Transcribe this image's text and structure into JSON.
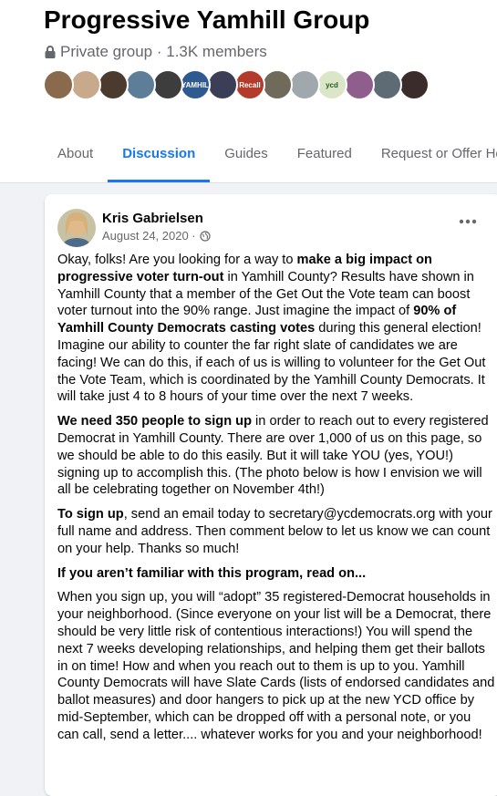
{
  "group": {
    "title": "Progressive Yamhill Group",
    "privacy": "Private group",
    "separator": " · ",
    "members": "1.3K members"
  },
  "member_avatars": [
    {
      "color": "#8a6a4c",
      "label": ""
    },
    {
      "color": "#c9a98b",
      "label": ""
    },
    {
      "color": "#4b3a2e",
      "label": ""
    },
    {
      "color": "#5e7d99",
      "label": ""
    },
    {
      "color": "#3d3d3d",
      "label": ""
    },
    {
      "color": "#2f5a8f",
      "label": "YAMHILL"
    },
    {
      "color": "#3a3f57",
      "label": ""
    },
    {
      "color": "#b43a2b",
      "label": "Recall"
    },
    {
      "color": "#6f6a5a",
      "label": ""
    },
    {
      "color": "#a0a7ad",
      "label": ""
    },
    {
      "color": "#dbe6c8",
      "label": "ycd"
    },
    {
      "color": "#8f5e8c",
      "label": ""
    },
    {
      "color": "#5f6b74",
      "label": ""
    },
    {
      "color": "#3a2c2a",
      "label": ""
    }
  ],
  "tabs": [
    {
      "label": "About",
      "active": false
    },
    {
      "label": "Discussion",
      "active": true
    },
    {
      "label": "Guides",
      "active": false
    },
    {
      "label": "Featured",
      "active": false
    },
    {
      "label": "Request or Offer He",
      "active": false
    }
  ],
  "post": {
    "author": "Kris Gabrielsen",
    "date": "August 24, 2020 ·",
    "paragraphs": [
      {
        "runs": [
          {
            "t": "Okay, folks! Are you looking for a way to ",
            "b": false
          },
          {
            "t": "make a big impact on progressive voter turn-out",
            "b": true
          },
          {
            "t": " in Yamhill County? Results have shown in Yamhill County that a member of the Get Out the Vote team can boost voter turnout into the 90% range. Just imagine the impact of ",
            "b": false
          },
          {
            "t": "90% of Yamhill County Democrats casting votes",
            "b": true
          },
          {
            "t": " during this general election! Imagine our ability to counter the far right slate of candidates we are facing! We can do this, if each of us is willing to volunteer for the Get Out the Vote Team, which is coordinated by the Yamhill County Democrats. It will take just 4 to 8 hours of your time over the next 7 weeks.",
            "b": false
          }
        ]
      },
      {
        "runs": [
          {
            "t": "We need 350 people to sign up",
            "b": true
          },
          {
            "t": " in order to reach out to every registered Democrat in Yamhill County. There are over 1,000 of us on this page, so we should be able to do this easily. But it will take YOU (yes, YOU!) signing up to accomplish this. (The photo below is how I envision we will all be celebrating together on November 4th!)",
            "b": false
          }
        ]
      },
      {
        "runs": [
          {
            "t": "To sign up",
            "b": true
          },
          {
            "t": ", send an email today to secretary@ycdemocrats.org with your full name and address. Then comment below to let us know we can count on your help. Thanks so much!",
            "b": false
          }
        ]
      },
      {
        "runs": [
          {
            "t": "If you aren’t familiar with this program, read on...",
            "b": true
          }
        ]
      },
      {
        "runs": [
          {
            "t": "When you sign up, you will “adopt” 35 registered-Democrat households in your neighborhood. (Since everyone on your list will be a Democrat, there should be very little risk of contentious interactions!) You will spend the next 7 weeks developing relationships, and helping them get their ballots in on time! How and when you reach out to them is up to you. Yamhill County Democrats will have Slate Cards (lists of endorsed candidates and ballot measures) and door hangers to pick up at the new YCD office by mid-September, which can be dropped off with a personal note, or you can call, send a letter.... whatever works for you and your neighborhood!",
            "b": false
          }
        ]
      }
    ]
  },
  "icons": {
    "privacy": "lock-icon",
    "audience": "globe-icon",
    "options": "more-options-icon"
  },
  "colors": {
    "accent": "#1877f2",
    "secondary_text": "#65676b",
    "background": "#f0f2f5"
  }
}
